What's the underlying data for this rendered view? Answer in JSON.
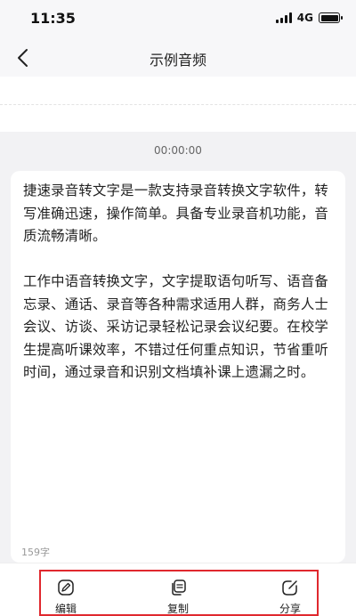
{
  "status_bar": {
    "time": "11:35",
    "network": "4G"
  },
  "nav": {
    "title": "示例音频",
    "back_icon": "chevron-left-icon"
  },
  "player": {
    "timer": "00:00:00"
  },
  "transcript": {
    "text": "捷速录音转文字是一款支持录音转换文字软件，转写准确迅速，操作简单。具备专业录音机功能，音质流畅清晰。\n\n工作中语音转换文字，文字提取语句听写、语音备忘录、通话、录音等各种需求适用人群，商务人士会议、访谈、采访记录轻松记录会议纪要。在校学生提高听课效率，不错过任何重点知识，节省重听时间，通过录音和识别文档填补课上遗漏之时。",
    "char_count": "159字"
  },
  "actions": {
    "edit": {
      "label": "编辑",
      "icon": "edit-icon"
    },
    "copy": {
      "label": "复制",
      "icon": "copy-icon"
    },
    "share": {
      "label": "分享",
      "icon": "share-icon"
    }
  },
  "colors": {
    "highlight": "#e0282e",
    "background": "#f2f2f4"
  }
}
